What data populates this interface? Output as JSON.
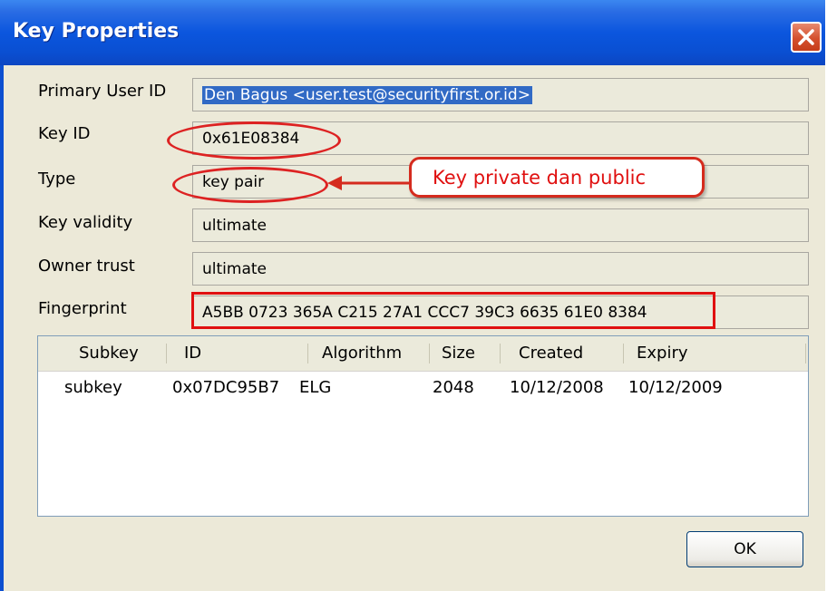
{
  "window": {
    "title": "Key Properties"
  },
  "fields": {
    "primary_user_id": {
      "label": "Primary User ID",
      "value": "Den Bagus <user.test@securityfirst.or.id>"
    },
    "key_id": {
      "label": "Key ID",
      "value": "0x61E08384"
    },
    "type": {
      "label": "Type",
      "value": "key pair"
    },
    "key_validity": {
      "label": "Key validity",
      "value": "ultimate"
    },
    "owner_trust": {
      "label": "Owner trust",
      "value": "ultimate"
    },
    "fingerprint": {
      "label": "Fingerprint",
      "value": "A5BB 0723 365A C215 27A1 CCC7 39C3 6635 61E0 8384"
    }
  },
  "annotation": {
    "callout_text": "Key private dan public",
    "color": "#e01010"
  },
  "subkeys": {
    "columns": [
      "Subkey",
      "ID",
      "Algorithm",
      "Size",
      "Created",
      "Expiry"
    ],
    "rows": [
      [
        "subkey",
        "0x07DC95B7",
        "ELG",
        "2048",
        "10/12/2008",
        "10/12/2009"
      ]
    ]
  },
  "buttons": {
    "ok": "OK"
  },
  "icons": {
    "close": "close-icon"
  },
  "colors": {
    "titlebar": "#0b56de",
    "dialog_bg": "#ece9d8",
    "selection": "#316ac5"
  }
}
